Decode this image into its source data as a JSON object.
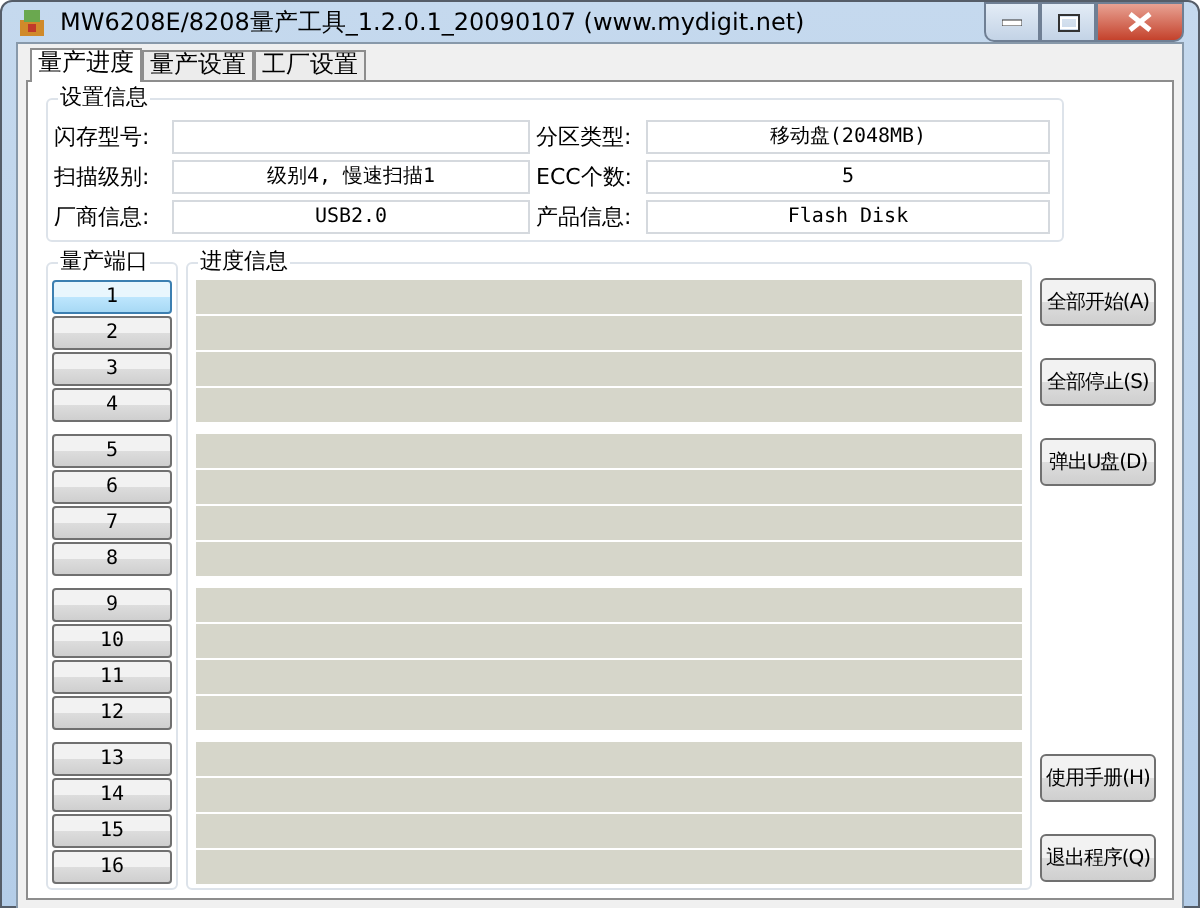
{
  "window": {
    "title": "MW6208E/8208量产工具_1.2.0.1_20090107 (www.mydigit.net)"
  },
  "tabs": [
    {
      "label": "量产进度",
      "selected": true
    },
    {
      "label": "量产设置",
      "selected": false
    },
    {
      "label": "工厂设置",
      "selected": false
    }
  ],
  "settings": {
    "title": "设置信息",
    "fields": [
      {
        "label": "闪存型号:"
      },
      {
        "label": "分区类型:",
        "value": "移动盘(2048MB)"
      },
      {
        "label": "扫描级别:",
        "value": "级别4, 慢速扫描1"
      },
      {
        "label": "ECC个数:",
        "value": "5"
      },
      {
        "label": "厂商信息:",
        "value": "USB2.0"
      },
      {
        "label": "产品信息:",
        "value": "Flash Disk"
      }
    ]
  },
  "ports": {
    "title": "量产端口",
    "items": [
      {
        "label": "1",
        "selected": true
      },
      {
        "label": "2",
        "selected": false
      },
      {
        "label": "3",
        "selected": false
      },
      {
        "label": "4",
        "selected": false
      },
      {
        "label": "5",
        "selected": false
      },
      {
        "label": "6",
        "selected": false
      },
      {
        "label": "7",
        "selected": false
      },
      {
        "label": "8",
        "selected": false
      },
      {
        "label": "9",
        "selected": false
      },
      {
        "label": "10",
        "selected": false
      },
      {
        "label": "11",
        "selected": false
      },
      {
        "label": "12",
        "selected": false
      },
      {
        "label": "13",
        "selected": false
      },
      {
        "label": "14",
        "selected": false
      },
      {
        "label": "15",
        "selected": false
      },
      {
        "label": "16",
        "selected": false
      }
    ]
  },
  "progress": {
    "title": "进度信息"
  },
  "buttons_top": [
    "全部开始(A)",
    "全部停止(S)",
    "弹出U盘(D)"
  ],
  "buttons_bottom": [
    "使用手册(H)",
    "退出程序(Q)"
  ]
}
